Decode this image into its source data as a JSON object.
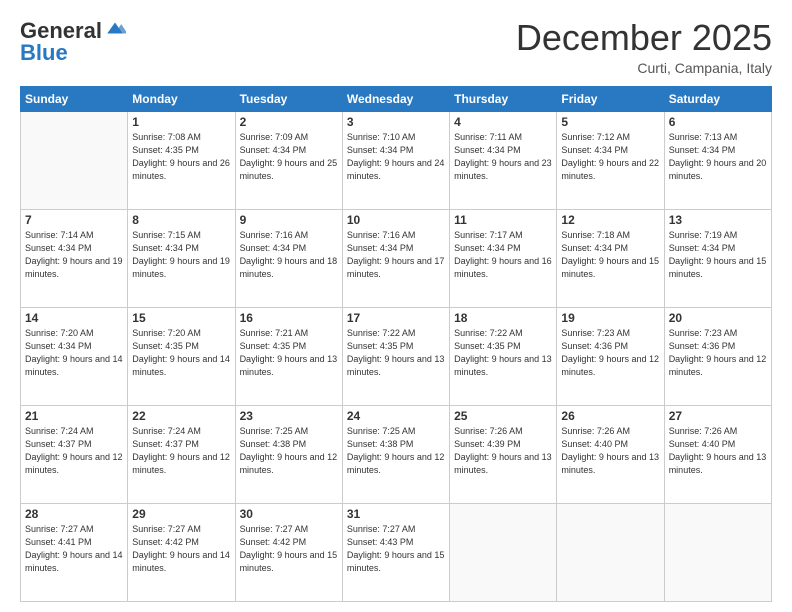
{
  "logo": {
    "general": "General",
    "blue": "Blue"
  },
  "header": {
    "month": "December 2025",
    "location": "Curti, Campania, Italy"
  },
  "weekdays": [
    "Sunday",
    "Monday",
    "Tuesday",
    "Wednesday",
    "Thursday",
    "Friday",
    "Saturday"
  ],
  "weeks": [
    [
      {
        "day": null
      },
      {
        "day": 1,
        "sunrise": "7:08 AM",
        "sunset": "4:35 PM",
        "daylight": "9 hours and 26 minutes."
      },
      {
        "day": 2,
        "sunrise": "7:09 AM",
        "sunset": "4:34 PM",
        "daylight": "9 hours and 25 minutes."
      },
      {
        "day": 3,
        "sunrise": "7:10 AM",
        "sunset": "4:34 PM",
        "daylight": "9 hours and 24 minutes."
      },
      {
        "day": 4,
        "sunrise": "7:11 AM",
        "sunset": "4:34 PM",
        "daylight": "9 hours and 23 minutes."
      },
      {
        "day": 5,
        "sunrise": "7:12 AM",
        "sunset": "4:34 PM",
        "daylight": "9 hours and 22 minutes."
      },
      {
        "day": 6,
        "sunrise": "7:13 AM",
        "sunset": "4:34 PM",
        "daylight": "9 hours and 20 minutes."
      }
    ],
    [
      {
        "day": 7,
        "sunrise": "7:14 AM",
        "sunset": "4:34 PM",
        "daylight": "9 hours and 19 minutes."
      },
      {
        "day": 8,
        "sunrise": "7:15 AM",
        "sunset": "4:34 PM",
        "daylight": "9 hours and 19 minutes."
      },
      {
        "day": 9,
        "sunrise": "7:16 AM",
        "sunset": "4:34 PM",
        "daylight": "9 hours and 18 minutes."
      },
      {
        "day": 10,
        "sunrise": "7:16 AM",
        "sunset": "4:34 PM",
        "daylight": "9 hours and 17 minutes."
      },
      {
        "day": 11,
        "sunrise": "7:17 AM",
        "sunset": "4:34 PM",
        "daylight": "9 hours and 16 minutes."
      },
      {
        "day": 12,
        "sunrise": "7:18 AM",
        "sunset": "4:34 PM",
        "daylight": "9 hours and 15 minutes."
      },
      {
        "day": 13,
        "sunrise": "7:19 AM",
        "sunset": "4:34 PM",
        "daylight": "9 hours and 15 minutes."
      }
    ],
    [
      {
        "day": 14,
        "sunrise": "7:20 AM",
        "sunset": "4:34 PM",
        "daylight": "9 hours and 14 minutes."
      },
      {
        "day": 15,
        "sunrise": "7:20 AM",
        "sunset": "4:35 PM",
        "daylight": "9 hours and 14 minutes."
      },
      {
        "day": 16,
        "sunrise": "7:21 AM",
        "sunset": "4:35 PM",
        "daylight": "9 hours and 13 minutes."
      },
      {
        "day": 17,
        "sunrise": "7:22 AM",
        "sunset": "4:35 PM",
        "daylight": "9 hours and 13 minutes."
      },
      {
        "day": 18,
        "sunrise": "7:22 AM",
        "sunset": "4:35 PM",
        "daylight": "9 hours and 13 minutes."
      },
      {
        "day": 19,
        "sunrise": "7:23 AM",
        "sunset": "4:36 PM",
        "daylight": "9 hours and 12 minutes."
      },
      {
        "day": 20,
        "sunrise": "7:23 AM",
        "sunset": "4:36 PM",
        "daylight": "9 hours and 12 minutes."
      }
    ],
    [
      {
        "day": 21,
        "sunrise": "7:24 AM",
        "sunset": "4:37 PM",
        "daylight": "9 hours and 12 minutes."
      },
      {
        "day": 22,
        "sunrise": "7:24 AM",
        "sunset": "4:37 PM",
        "daylight": "9 hours and 12 minutes."
      },
      {
        "day": 23,
        "sunrise": "7:25 AM",
        "sunset": "4:38 PM",
        "daylight": "9 hours and 12 minutes."
      },
      {
        "day": 24,
        "sunrise": "7:25 AM",
        "sunset": "4:38 PM",
        "daylight": "9 hours and 12 minutes."
      },
      {
        "day": 25,
        "sunrise": "7:26 AM",
        "sunset": "4:39 PM",
        "daylight": "9 hours and 13 minutes."
      },
      {
        "day": 26,
        "sunrise": "7:26 AM",
        "sunset": "4:40 PM",
        "daylight": "9 hours and 13 minutes."
      },
      {
        "day": 27,
        "sunrise": "7:26 AM",
        "sunset": "4:40 PM",
        "daylight": "9 hours and 13 minutes."
      }
    ],
    [
      {
        "day": 28,
        "sunrise": "7:27 AM",
        "sunset": "4:41 PM",
        "daylight": "9 hours and 14 minutes."
      },
      {
        "day": 29,
        "sunrise": "7:27 AM",
        "sunset": "4:42 PM",
        "daylight": "9 hours and 14 minutes."
      },
      {
        "day": 30,
        "sunrise": "7:27 AM",
        "sunset": "4:42 PM",
        "daylight": "9 hours and 15 minutes."
      },
      {
        "day": 31,
        "sunrise": "7:27 AM",
        "sunset": "4:43 PM",
        "daylight": "9 hours and 15 minutes."
      },
      {
        "day": null
      },
      {
        "day": null
      },
      {
        "day": null
      }
    ]
  ],
  "labels": {
    "sunrise": "Sunrise: ",
    "sunset": "Sunset: ",
    "daylight": "Daylight: "
  }
}
